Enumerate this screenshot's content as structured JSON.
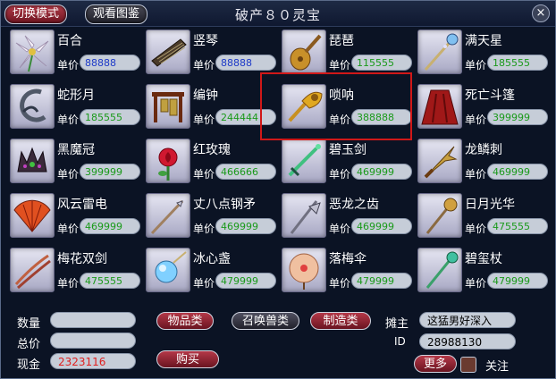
{
  "header": {
    "switch_mode": "切换模式",
    "view_catalog": "观看图鉴",
    "title": "破产８０灵宝",
    "close": "×"
  },
  "price_label": "单价",
  "price_color": "#1a9a1a",
  "price_color_blue": "#1e3ac8",
  "items": [
    {
      "name": "百合",
      "price": "88888",
      "icon": "lily-icon"
    },
    {
      "name": "竖琴",
      "price": "88888",
      "icon": "harp-icon"
    },
    {
      "name": "琵琶",
      "price": "115555",
      "icon": "pipa-icon"
    },
    {
      "name": "满天星",
      "price": "185555",
      "icon": "staff-icon"
    },
    {
      "name": "蛇形月",
      "price": "185555",
      "icon": "serpent-moon-icon"
    },
    {
      "name": "编钟",
      "price": "244444",
      "icon": "chime-bells-icon"
    },
    {
      "name": "唢呐",
      "price": "388888",
      "icon": "suona-icon"
    },
    {
      "name": "死亡斗篷",
      "price": "399999",
      "icon": "cloak-icon"
    },
    {
      "name": "黑魔冠",
      "price": "399999",
      "icon": "crown-icon"
    },
    {
      "name": "红玫瑰",
      "price": "466666",
      "icon": "rose-icon"
    },
    {
      "name": "碧玉剑",
      "price": "469999",
      "icon": "sword-icon"
    },
    {
      "name": "龙鳞刺",
      "price": "469999",
      "icon": "spike-icon"
    },
    {
      "name": "风云雷电",
      "price": "469999",
      "icon": "fan-icon"
    },
    {
      "name": "丈八点钢矛",
      "price": "469999",
      "icon": "spear-icon"
    },
    {
      "name": "恶龙之齿",
      "price": "469999",
      "icon": "halberd-icon"
    },
    {
      "name": "日月光华",
      "price": "475555",
      "icon": "mace-icon"
    },
    {
      "name": "梅花双剑",
      "price": "475555",
      "icon": "twin-blades-icon"
    },
    {
      "name": "冰心盏",
      "price": "479999",
      "icon": "ice-orb-icon"
    },
    {
      "name": "落梅伞",
      "price": "479999",
      "icon": "umbrella-icon"
    },
    {
      "name": "碧玺杖",
      "price": "479999",
      "icon": "scepter-icon"
    }
  ],
  "bottom": {
    "quantity_label": "数量",
    "quantity_value": "",
    "total_label": "总价",
    "total_value": "",
    "cash_label": "现金",
    "cash_value": "2323116",
    "cash_color": "#e02020",
    "tab_items": "物品类",
    "tab_pets": "召唤兽类",
    "tab_crafting": "制造类",
    "buy": "购买",
    "seller_label": "摊主",
    "seller_name": "这猛男好深入",
    "id_label": "ID",
    "id_value": "28988130",
    "more": "更多",
    "follow": "关注"
  }
}
